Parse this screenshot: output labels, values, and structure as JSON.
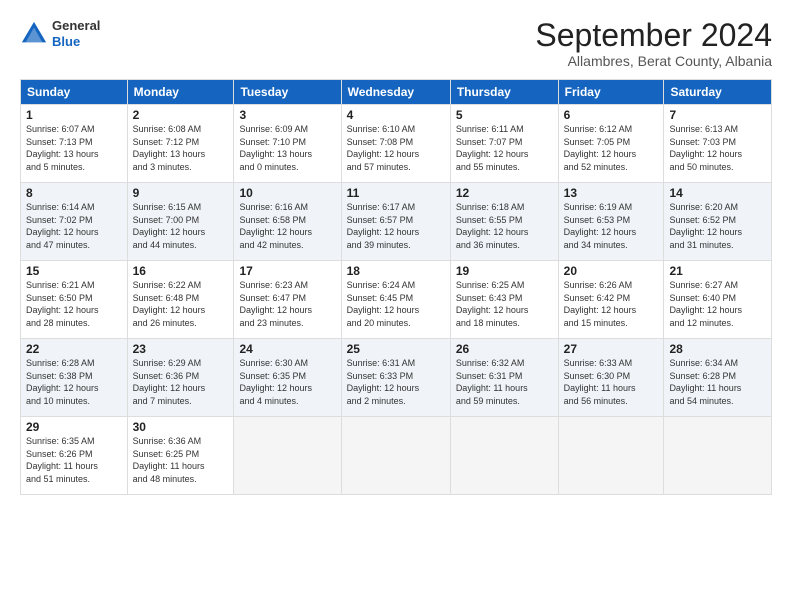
{
  "header": {
    "logo_general": "General",
    "logo_blue": "Blue",
    "month_title": "September 2024",
    "subtitle": "Allambres, Berat County, Albania"
  },
  "days_of_week": [
    "Sunday",
    "Monday",
    "Tuesday",
    "Wednesday",
    "Thursday",
    "Friday",
    "Saturday"
  ],
  "weeks": [
    [
      {
        "day": "1",
        "info": "Sunrise: 6:07 AM\nSunset: 7:13 PM\nDaylight: 13 hours\nand 5 minutes."
      },
      {
        "day": "2",
        "info": "Sunrise: 6:08 AM\nSunset: 7:12 PM\nDaylight: 13 hours\nand 3 minutes."
      },
      {
        "day": "3",
        "info": "Sunrise: 6:09 AM\nSunset: 7:10 PM\nDaylight: 13 hours\nand 0 minutes."
      },
      {
        "day": "4",
        "info": "Sunrise: 6:10 AM\nSunset: 7:08 PM\nDaylight: 12 hours\nand 57 minutes."
      },
      {
        "day": "5",
        "info": "Sunrise: 6:11 AM\nSunset: 7:07 PM\nDaylight: 12 hours\nand 55 minutes."
      },
      {
        "day": "6",
        "info": "Sunrise: 6:12 AM\nSunset: 7:05 PM\nDaylight: 12 hours\nand 52 minutes."
      },
      {
        "day": "7",
        "info": "Sunrise: 6:13 AM\nSunset: 7:03 PM\nDaylight: 12 hours\nand 50 minutes."
      }
    ],
    [
      {
        "day": "8",
        "info": "Sunrise: 6:14 AM\nSunset: 7:02 PM\nDaylight: 12 hours\nand 47 minutes."
      },
      {
        "day": "9",
        "info": "Sunrise: 6:15 AM\nSunset: 7:00 PM\nDaylight: 12 hours\nand 44 minutes."
      },
      {
        "day": "10",
        "info": "Sunrise: 6:16 AM\nSunset: 6:58 PM\nDaylight: 12 hours\nand 42 minutes."
      },
      {
        "day": "11",
        "info": "Sunrise: 6:17 AM\nSunset: 6:57 PM\nDaylight: 12 hours\nand 39 minutes."
      },
      {
        "day": "12",
        "info": "Sunrise: 6:18 AM\nSunset: 6:55 PM\nDaylight: 12 hours\nand 36 minutes."
      },
      {
        "day": "13",
        "info": "Sunrise: 6:19 AM\nSunset: 6:53 PM\nDaylight: 12 hours\nand 34 minutes."
      },
      {
        "day": "14",
        "info": "Sunrise: 6:20 AM\nSunset: 6:52 PM\nDaylight: 12 hours\nand 31 minutes."
      }
    ],
    [
      {
        "day": "15",
        "info": "Sunrise: 6:21 AM\nSunset: 6:50 PM\nDaylight: 12 hours\nand 28 minutes."
      },
      {
        "day": "16",
        "info": "Sunrise: 6:22 AM\nSunset: 6:48 PM\nDaylight: 12 hours\nand 26 minutes."
      },
      {
        "day": "17",
        "info": "Sunrise: 6:23 AM\nSunset: 6:47 PM\nDaylight: 12 hours\nand 23 minutes."
      },
      {
        "day": "18",
        "info": "Sunrise: 6:24 AM\nSunset: 6:45 PM\nDaylight: 12 hours\nand 20 minutes."
      },
      {
        "day": "19",
        "info": "Sunrise: 6:25 AM\nSunset: 6:43 PM\nDaylight: 12 hours\nand 18 minutes."
      },
      {
        "day": "20",
        "info": "Sunrise: 6:26 AM\nSunset: 6:42 PM\nDaylight: 12 hours\nand 15 minutes."
      },
      {
        "day": "21",
        "info": "Sunrise: 6:27 AM\nSunset: 6:40 PM\nDaylight: 12 hours\nand 12 minutes."
      }
    ],
    [
      {
        "day": "22",
        "info": "Sunrise: 6:28 AM\nSunset: 6:38 PM\nDaylight: 12 hours\nand 10 minutes."
      },
      {
        "day": "23",
        "info": "Sunrise: 6:29 AM\nSunset: 6:36 PM\nDaylight: 12 hours\nand 7 minutes."
      },
      {
        "day": "24",
        "info": "Sunrise: 6:30 AM\nSunset: 6:35 PM\nDaylight: 12 hours\nand 4 minutes."
      },
      {
        "day": "25",
        "info": "Sunrise: 6:31 AM\nSunset: 6:33 PM\nDaylight: 12 hours\nand 2 minutes."
      },
      {
        "day": "26",
        "info": "Sunrise: 6:32 AM\nSunset: 6:31 PM\nDaylight: 11 hours\nand 59 minutes."
      },
      {
        "day": "27",
        "info": "Sunrise: 6:33 AM\nSunset: 6:30 PM\nDaylight: 11 hours\nand 56 minutes."
      },
      {
        "day": "28",
        "info": "Sunrise: 6:34 AM\nSunset: 6:28 PM\nDaylight: 11 hours\nand 54 minutes."
      }
    ],
    [
      {
        "day": "29",
        "info": "Sunrise: 6:35 AM\nSunset: 6:26 PM\nDaylight: 11 hours\nand 51 minutes."
      },
      {
        "day": "30",
        "info": "Sunrise: 6:36 AM\nSunset: 6:25 PM\nDaylight: 11 hours\nand 48 minutes."
      },
      {
        "day": "",
        "info": ""
      },
      {
        "day": "",
        "info": ""
      },
      {
        "day": "",
        "info": ""
      },
      {
        "day": "",
        "info": ""
      },
      {
        "day": "",
        "info": ""
      }
    ]
  ]
}
